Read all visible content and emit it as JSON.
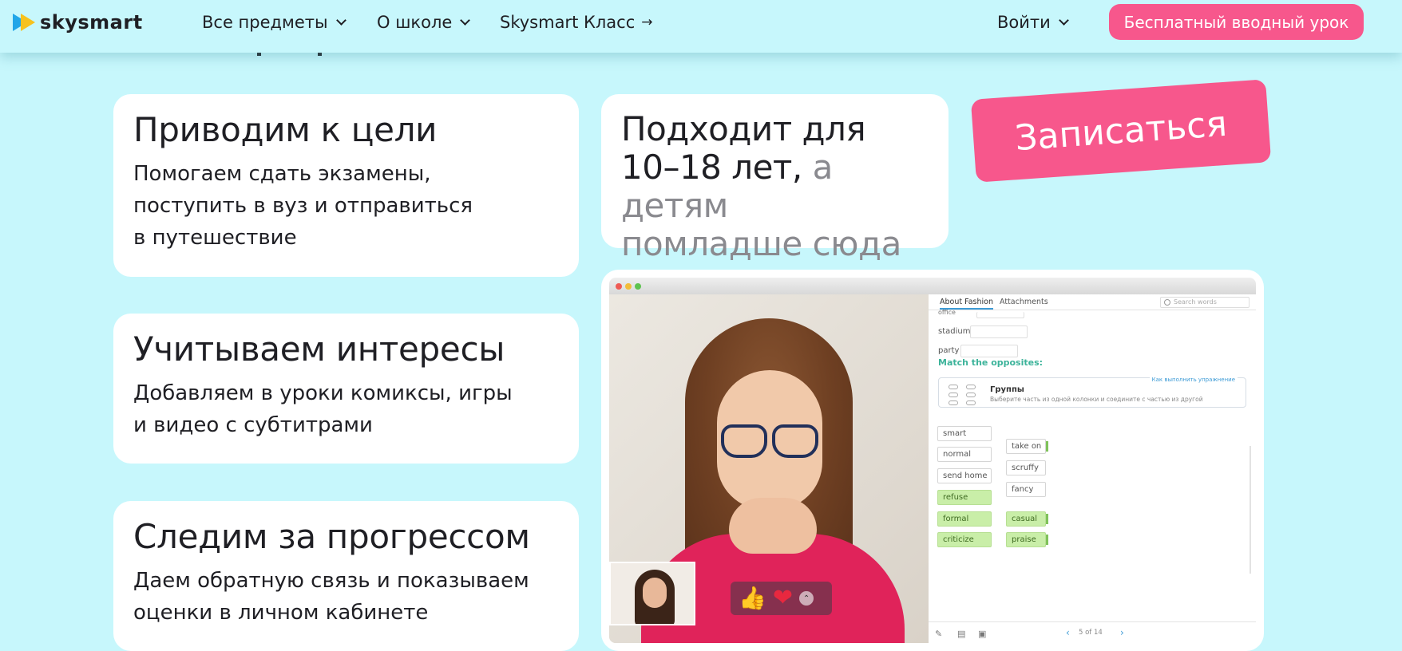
{
  "header": {
    "logo_text": "skysmart",
    "nav": [
      {
        "label": "Все предметы",
        "icon": "chevron-down-icon"
      },
      {
        "label": "О школе",
        "icon": "chevron-down-icon"
      },
      {
        "label": "Skysmart Класс",
        "icon": "arrow-right-icon",
        "glyph": "→"
      }
    ],
    "login_label": "Войти",
    "cta_label": "Бесплатный вводный урок",
    "colors": {
      "background": "#c7f7fc",
      "accent": "#f7578c"
    }
  },
  "cards": [
    {
      "title": "Приводим к цели",
      "text_lines": [
        "Помогаем сдать экзамены,",
        "поступить в вуз и отправиться",
        "в путешествие"
      ]
    },
    {
      "title": "Учитываем интересы",
      "text_lines": [
        "Добавляем в уроки комиксы, игры",
        "и видео с субтитрами"
      ]
    },
    {
      "title": "Следим за прогрессом",
      "text_lines": [
        "Даем обратную связь и показываем",
        "оценки в личном кабинете"
      ]
    }
  ],
  "age_card": {
    "line1": "Подходит для",
    "age": "10–18 лет,",
    "link_part1": "а детям",
    "link_part2": "помладше сюда",
    "arrow": "→"
  },
  "signup_label": "Записаться",
  "lesson": {
    "tabs": [
      "About Fashion",
      "Attachments"
    ],
    "search_placeholder": "Search words",
    "cutoff_word": "office",
    "words": [
      "stadium",
      "party"
    ],
    "task_title": "Match the opposites:",
    "hint": {
      "title": "Группы",
      "description": "Выберите часть из одной колонки и соедините с частью из другой",
      "link": "Как выполнить упражнение"
    },
    "left_column": [
      "smart",
      "normal",
      "send home",
      "refuse",
      "formal",
      "criticize"
    ],
    "right_column": [
      "take on",
      "scruffy",
      "fancy",
      "casual",
      "praise"
    ],
    "matched_left": [
      "refuse",
      "formal",
      "criticize"
    ],
    "matched_right": [
      "take on",
      "casual",
      "praise"
    ],
    "pager": "5 of 14"
  },
  "reactions": [
    {
      "name": "thumbs-up-icon",
      "glyph": "👍"
    },
    {
      "name": "heart-icon",
      "glyph": "❤"
    },
    {
      "name": "more-reactions-icon",
      "glyph": "⌃"
    }
  ]
}
